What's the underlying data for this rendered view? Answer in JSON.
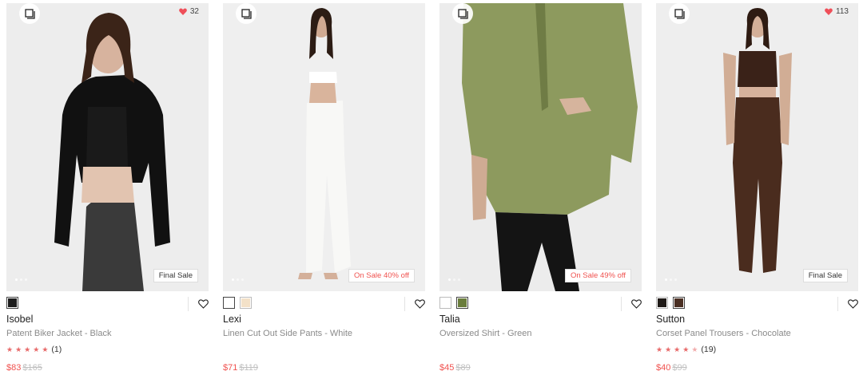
{
  "colors": {
    "sale": "#f0524f",
    "star": "#e86a6a",
    "heart": "#ef4f59"
  },
  "products": [
    {
      "name": "Isobel",
      "description": "Patent Biker Jacket - Black",
      "likes": "32",
      "badge": "Final Sale",
      "badge_type": "final",
      "rating_stars": 5,
      "rating_count": "(1)",
      "price": "$83",
      "was_price": "$165",
      "swatches": [
        "#1c1c1c"
      ]
    },
    {
      "name": "Lexi",
      "description": "Linen Cut Out Side Pants - White",
      "likes": "",
      "badge": "On Sale 40% off",
      "badge_type": "sale",
      "rating_stars": 0,
      "rating_count": "",
      "price": "$71",
      "was_price": "$119",
      "swatches": [
        "#ffffff",
        "#f3e1c8"
      ]
    },
    {
      "name": "Talia",
      "description": "Oversized Shirt - Green",
      "likes": "",
      "badge": "On Sale 49% off",
      "badge_type": "sale",
      "rating_stars": 0,
      "rating_count": "",
      "price": "$45",
      "was_price": "$89",
      "swatches": [
        "#ffffff",
        "#6a7d3c"
      ]
    },
    {
      "name": "Sutton",
      "description": "Corset Panel Trousers - Chocolate",
      "likes": "113",
      "badge": "Final Sale",
      "badge_type": "final",
      "rating_stars": 4.5,
      "rating_count": "(19)",
      "price": "$40",
      "was_price": "$99",
      "swatches": [
        "#1f1a17",
        "#4a2f23"
      ]
    }
  ]
}
